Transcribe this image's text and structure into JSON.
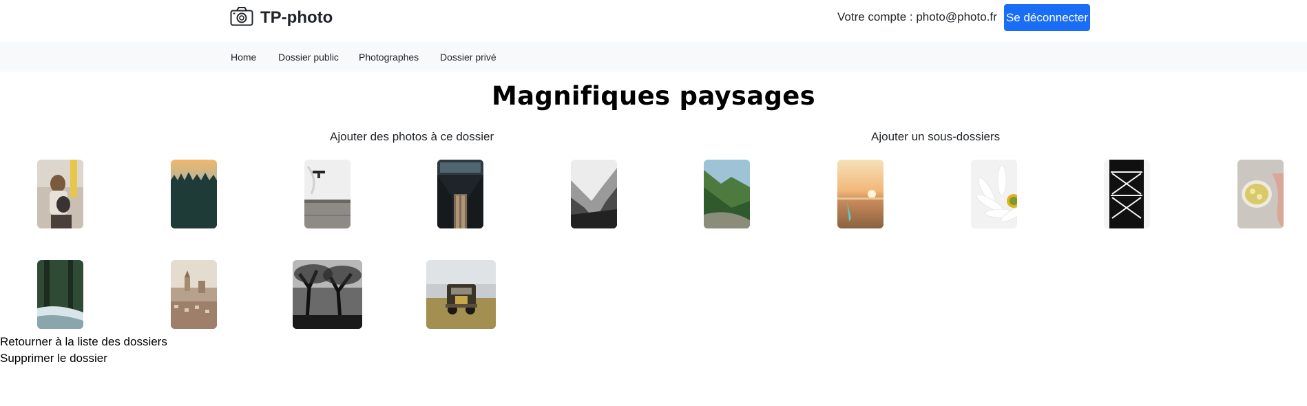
{
  "header": {
    "brand_name": "TP-photo",
    "brand_icon": "camera-icon",
    "account_text": "Votre compte : photo@photo.fr",
    "logout_label": "Se déconnecter",
    "accent_color": "#1a6ef5"
  },
  "nav": {
    "items": [
      {
        "label": "Home"
      },
      {
        "label": "Dossier public"
      },
      {
        "label": "Photographes"
      },
      {
        "label": "Dossier privé"
      }
    ]
  },
  "main": {
    "title": "Magnifiques paysages",
    "add_photos_label": "Ajouter des photos à ce dossier",
    "add_subfolder_label": "Ajouter un sous-dossiers",
    "photos": [
      {
        "subject": "mother and child on street"
      },
      {
        "subject": "forest at dusk"
      },
      {
        "subject": "snowy wall with lamp"
      },
      {
        "subject": "train station escalator"
      },
      {
        "subject": "misty mountains black and white"
      },
      {
        "subject": "green mountain tunnel"
      },
      {
        "subject": "beach sunset"
      },
      {
        "subject": "white daisy"
      },
      {
        "subject": "black metal tower"
      },
      {
        "subject": "lemon tea cup in hand"
      },
      {
        "subject": "forest river"
      },
      {
        "subject": "city skyline"
      },
      {
        "subject": "dark trees black and white"
      },
      {
        "subject": "vintage truck in field"
      }
    ],
    "back_link": "Retourner à la liste des dossiers",
    "delete_link": "Supprimer le dossier"
  }
}
